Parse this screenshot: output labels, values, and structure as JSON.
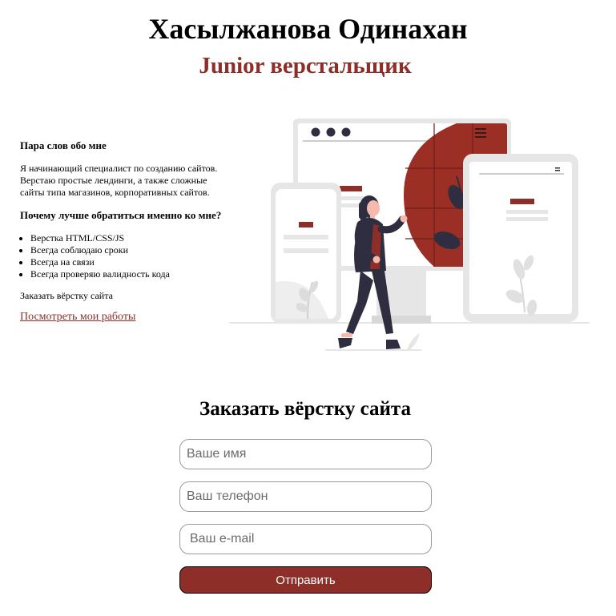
{
  "header": {
    "name": "Хасылжанова Одинахан",
    "role": "Junior верстальщик"
  },
  "about": {
    "heading": "Пара слов обо мне",
    "text": "Я начинающий специалист по созданию сайтов. Верстаю простые лендинги, а также сложные сайты типа магазинов, корпоративных сайтов.",
    "why_heading": "Почему лучше обратиться именно ко мне?",
    "reasons": [
      "Верстка HTML/CSS/JS",
      "Всегда соблюдаю сроки",
      "Всегда на связи",
      "Всегда проверяю валидность кода"
    ],
    "cta_text": "Заказать вёрстку сайта",
    "portfolio_link": "Посмотреть мои работы"
  },
  "order_form": {
    "title": "Заказать вёрстку сайта",
    "name_placeholder": "Ваше имя",
    "phone_placeholder": "Ваш телефон",
    "email_placeholder": "Ваш e-mail",
    "submit_label": "Отправить"
  },
  "colors": {
    "accent": "#8e2e28",
    "light_gray": "#e6e6e6",
    "dark": "#2f2e41"
  }
}
